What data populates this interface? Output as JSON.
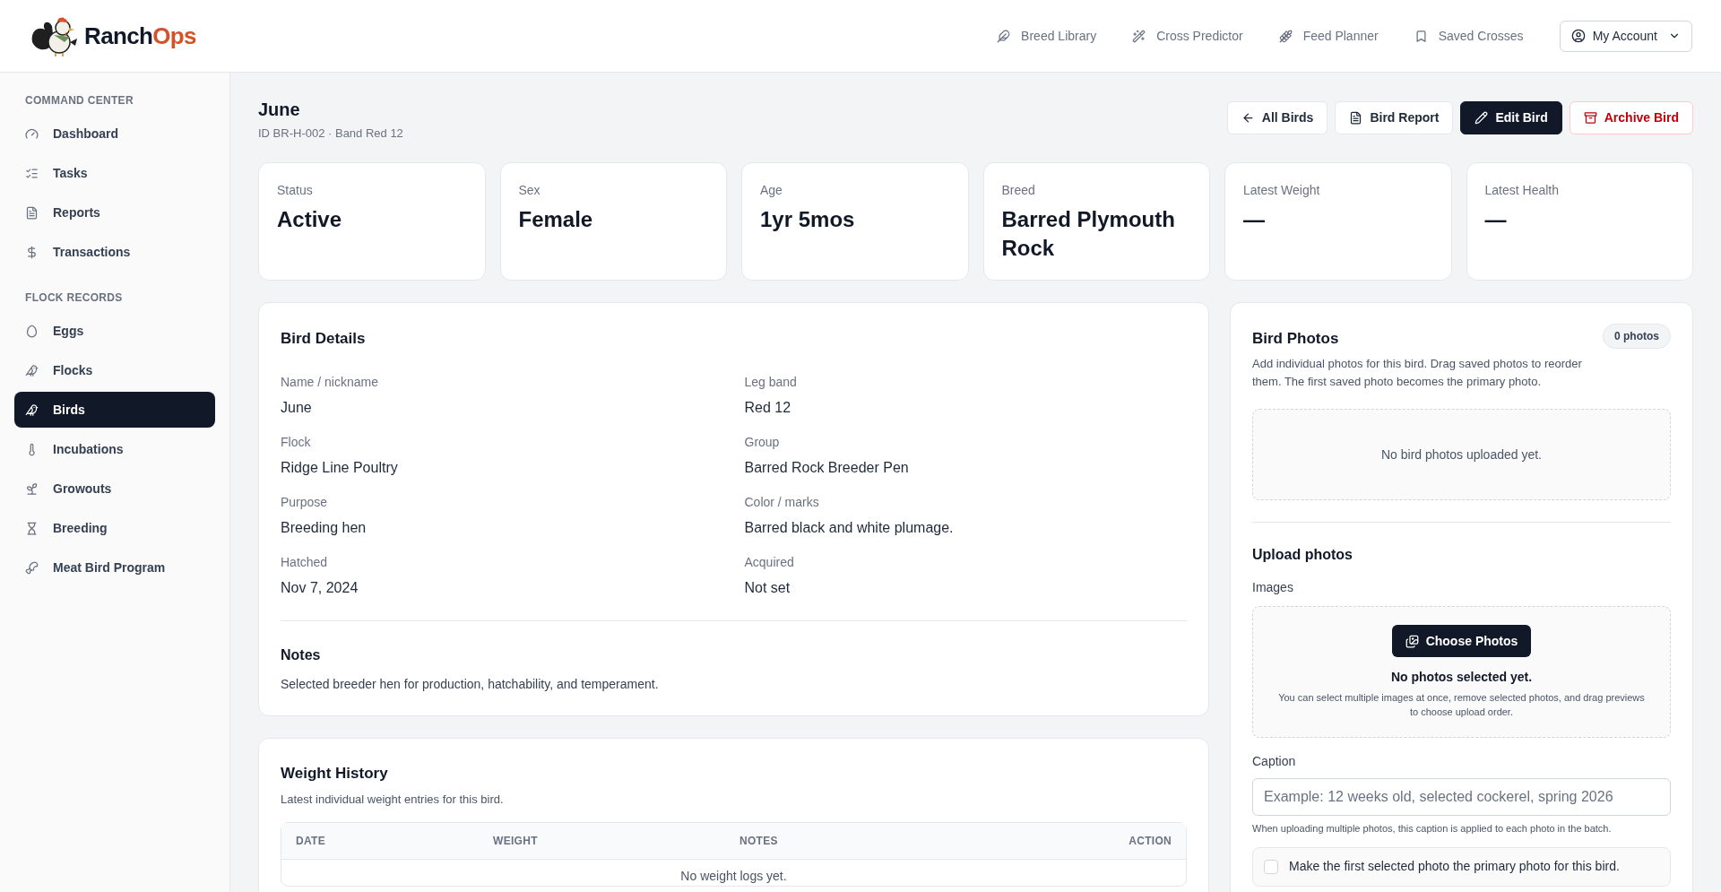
{
  "header": {
    "brand_parts": [
      "Ranch",
      "Ops"
    ],
    "nav_links": [
      {
        "label": "Breed Library"
      },
      {
        "label": "Cross Predictor"
      },
      {
        "label": "Feed Planner"
      },
      {
        "label": "Saved Crosses"
      }
    ],
    "account_menu": {
      "label": "My Account"
    }
  },
  "sidebar": {
    "sections": [
      {
        "title": "COMMAND CENTER",
        "items": [
          {
            "label": "Dashboard",
            "selected": false
          },
          {
            "label": "Tasks",
            "selected": false
          },
          {
            "label": "Reports",
            "selected": false
          },
          {
            "label": "Transactions",
            "selected": false
          }
        ]
      },
      {
        "title": "FLOCK RECORDS",
        "items": [
          {
            "label": "Eggs",
            "selected": false
          },
          {
            "label": "Flocks",
            "selected": false
          },
          {
            "label": "Birds",
            "selected": true
          },
          {
            "label": "Incubations",
            "selected": false
          },
          {
            "label": "Growouts",
            "selected": false
          },
          {
            "label": "Breeding",
            "selected": false
          },
          {
            "label": "Meat Bird Program",
            "selected": false
          }
        ]
      }
    ]
  },
  "page": {
    "title": "June",
    "subtitle": "ID BR-H-002 · Band Red 12",
    "actions": [
      {
        "label": "All Birds",
        "kind": "back"
      },
      {
        "label": "Bird Report",
        "kind": "report"
      },
      {
        "label": "Edit Bird",
        "kind": "primary"
      },
      {
        "label": "Archive Bird",
        "kind": "danger"
      }
    ]
  },
  "stats": [
    {
      "label": "Status",
      "value": "Active"
    },
    {
      "label": "Sex",
      "value": "Female"
    },
    {
      "label": "Age",
      "value": "1yr 5mos"
    },
    {
      "label": "Breed",
      "value": "Barred Plymouth Rock"
    },
    {
      "label": "Latest Weight",
      "value": "—"
    },
    {
      "label": "Latest Health",
      "value": "—"
    }
  ],
  "bird_details": {
    "title": "Bird Details",
    "fields": [
      {
        "label": "Name / nickname",
        "value": "June"
      },
      {
        "label": "Leg band",
        "value": "Red 12"
      },
      {
        "label": "Flock",
        "value": "Ridge Line Poultry"
      },
      {
        "label": "Group",
        "value": "Barred Rock Breeder Pen"
      },
      {
        "label": "Purpose",
        "value": "Breeding hen"
      },
      {
        "label": "Color / marks",
        "value": "Barred black and white plumage."
      },
      {
        "label": "Hatched",
        "value": "Nov 7, 2024"
      },
      {
        "label": "Acquired",
        "value": "Not set"
      }
    ],
    "notes_title": "Notes",
    "notes": "Selected breeder hen for production, hatchability, and temperament."
  },
  "weight_history": {
    "title": "Weight History",
    "subtitle": "Latest individual weight entries for this bird.",
    "table": {
      "columns": [
        "DATE",
        "WEIGHT",
        "NOTES",
        "ACTION"
      ],
      "empty_message": "No weight logs yet."
    }
  },
  "bird_photos": {
    "title": "Bird Photos",
    "count_badge": "0 photos",
    "description": "Add individual photos for this bird. Drag saved photos to reorder them. The first saved photo becomes the primary photo.",
    "empty_message": "No bird photos uploaded yet.",
    "upload": {
      "title": "Upload photos",
      "images_label": "Images",
      "choose_button": "Choose Photos",
      "selection_status": "No photos selected yet.",
      "selection_hint": "You can select multiple images at once, remove selected photos, and drag previews to choose upload order.",
      "caption_label": "Caption",
      "caption_placeholder": "Example: 12 weeks old, selected cockerel, spring 2026",
      "caption_help": "When uploading multiple photos, this caption is applied to each photo in the batch.",
      "primary_checkbox": {
        "label": "Make the first selected photo the primary photo for this bird.",
        "checked": false
      }
    }
  }
}
